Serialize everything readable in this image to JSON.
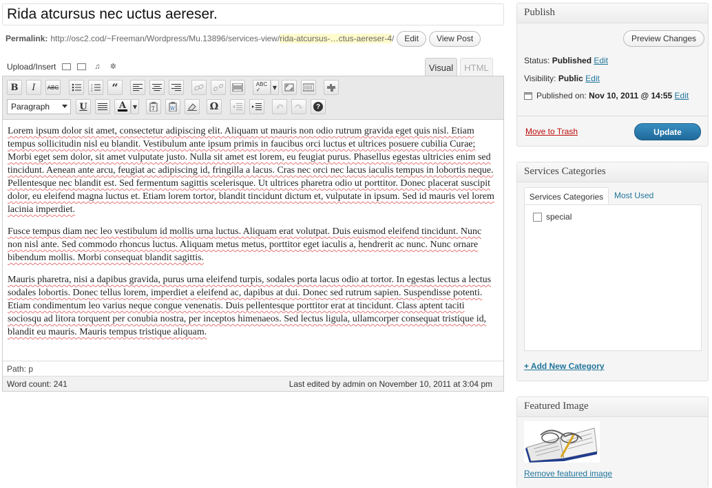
{
  "post": {
    "title": "Rida atcursus nec uctus aereser.",
    "permalink_label": "Permalink:",
    "permalink_base": "http://osc2.cod/~Freeman/Wordpress/Mu.13896/services-view/",
    "permalink_slug": "rida-atcursus-…ctus-aereser-4",
    "permalink_end": "/",
    "edit_label": "Edit",
    "view_post_label": "View Post"
  },
  "media": {
    "upload_insert_label": "Upload/Insert"
  },
  "editor_tabs": {
    "visual": "Visual",
    "html": "HTML"
  },
  "toolbar": {
    "format_select_value": "Paragraph",
    "bold": "B",
    "italic": "I",
    "strike": "ABC",
    "quote": "“",
    "omega": "Ω",
    "help": "?"
  },
  "content": {
    "paragraphs": [
      "Lorem ipsum dolor sit amet, consectetur adipiscing elit. Aliquam ut mauris non odio rutrum gravida eget quis nisl. Etiam tempus sollicitudin nisl eu blandit. Vestibulum ante ipsum primis in faucibus orci luctus et ultrices posuere cubilia Curae; Morbi eget sem dolor, sit amet vulputate justo. Nulla sit amet est lorem, eu feugiat purus. Phasellus egestas ultricies enim sed tincidunt. Aenean ante arcu, feugiat ac adipiscing id, fringilla a lacus. Cras nec orci nec lacus iaculis tempus in lobortis neque. Pellentesque nec blandit est. Sed fermentum sagittis scelerisque. Ut ultrices pharetra odio ut porttitor. Donec placerat suscipit dolor, eu eleifend magna luctus et. Etiam lorem tortor, blandit tincidunt dictum et, vulputate in ipsum. Sed id mauris vel lorem lacinia imperdiet.",
      "Fusce tempus diam nec leo vestibulum id mollis urna luctus. Aliquam erat volutpat. Duis euismod eleifend tincidunt. Nunc non nisl ante. Sed commodo rhoncus luctus. Aliquam metus metus, porttitor eget iaculis a, hendrerit ac nunc. Nunc ornare bibendum mollis. Morbi consequat blandit sagittis.",
      "Mauris pharetra, nisi a dapibus gravida, purus urna eleifend turpis, sodales porta lacus odio at tortor. In egestas lectus a lectus sodales lobortis. Donec tellus lorem, imperdiet a eleifend ac, dapibus at dui. Donec sed rutrum sapien. Suspendisse potenti. Etiam condimentum leo varius neque congue venenatis. Duis pellentesque porttitor erat at tincidunt. Class aptent taciti sociosqu ad litora torquent per conubia nostra, per inceptos himenaeos. Sed lectus ligula, ullamcorper consequat tristique id, blandit eu mauris. Mauris tempus tristique aliquam."
    ]
  },
  "status_bar": {
    "path": "Path: p",
    "word_count": "Word count: 241",
    "last_edited": "Last edited by admin on November 10, 2011 at 3:04 pm"
  },
  "publish": {
    "heading": "Publish",
    "preview_label": "Preview Changes",
    "status_label": "Status:",
    "status_value": "Published",
    "visibility_label": "Visibility:",
    "visibility_value": "Public",
    "published_on_label": "Published on:",
    "published_on_value": "Nov 10, 2011 @ 14:55",
    "edit_label": "Edit",
    "trash_label": "Move to Trash",
    "update_label": "Update"
  },
  "categories": {
    "heading": "Services Categories",
    "tab_all": "Services Categories",
    "tab_used": "Most Used",
    "items": [
      {
        "label": "special",
        "checked": false
      }
    ],
    "add_new_label": "+ Add New Category"
  },
  "featured": {
    "heading": "Featured Image",
    "remove_label": "Remove featured image"
  },
  "colors": {
    "link": "#21759b",
    "update_button": "#2a7ab0",
    "trash": "#bc0b0b"
  }
}
